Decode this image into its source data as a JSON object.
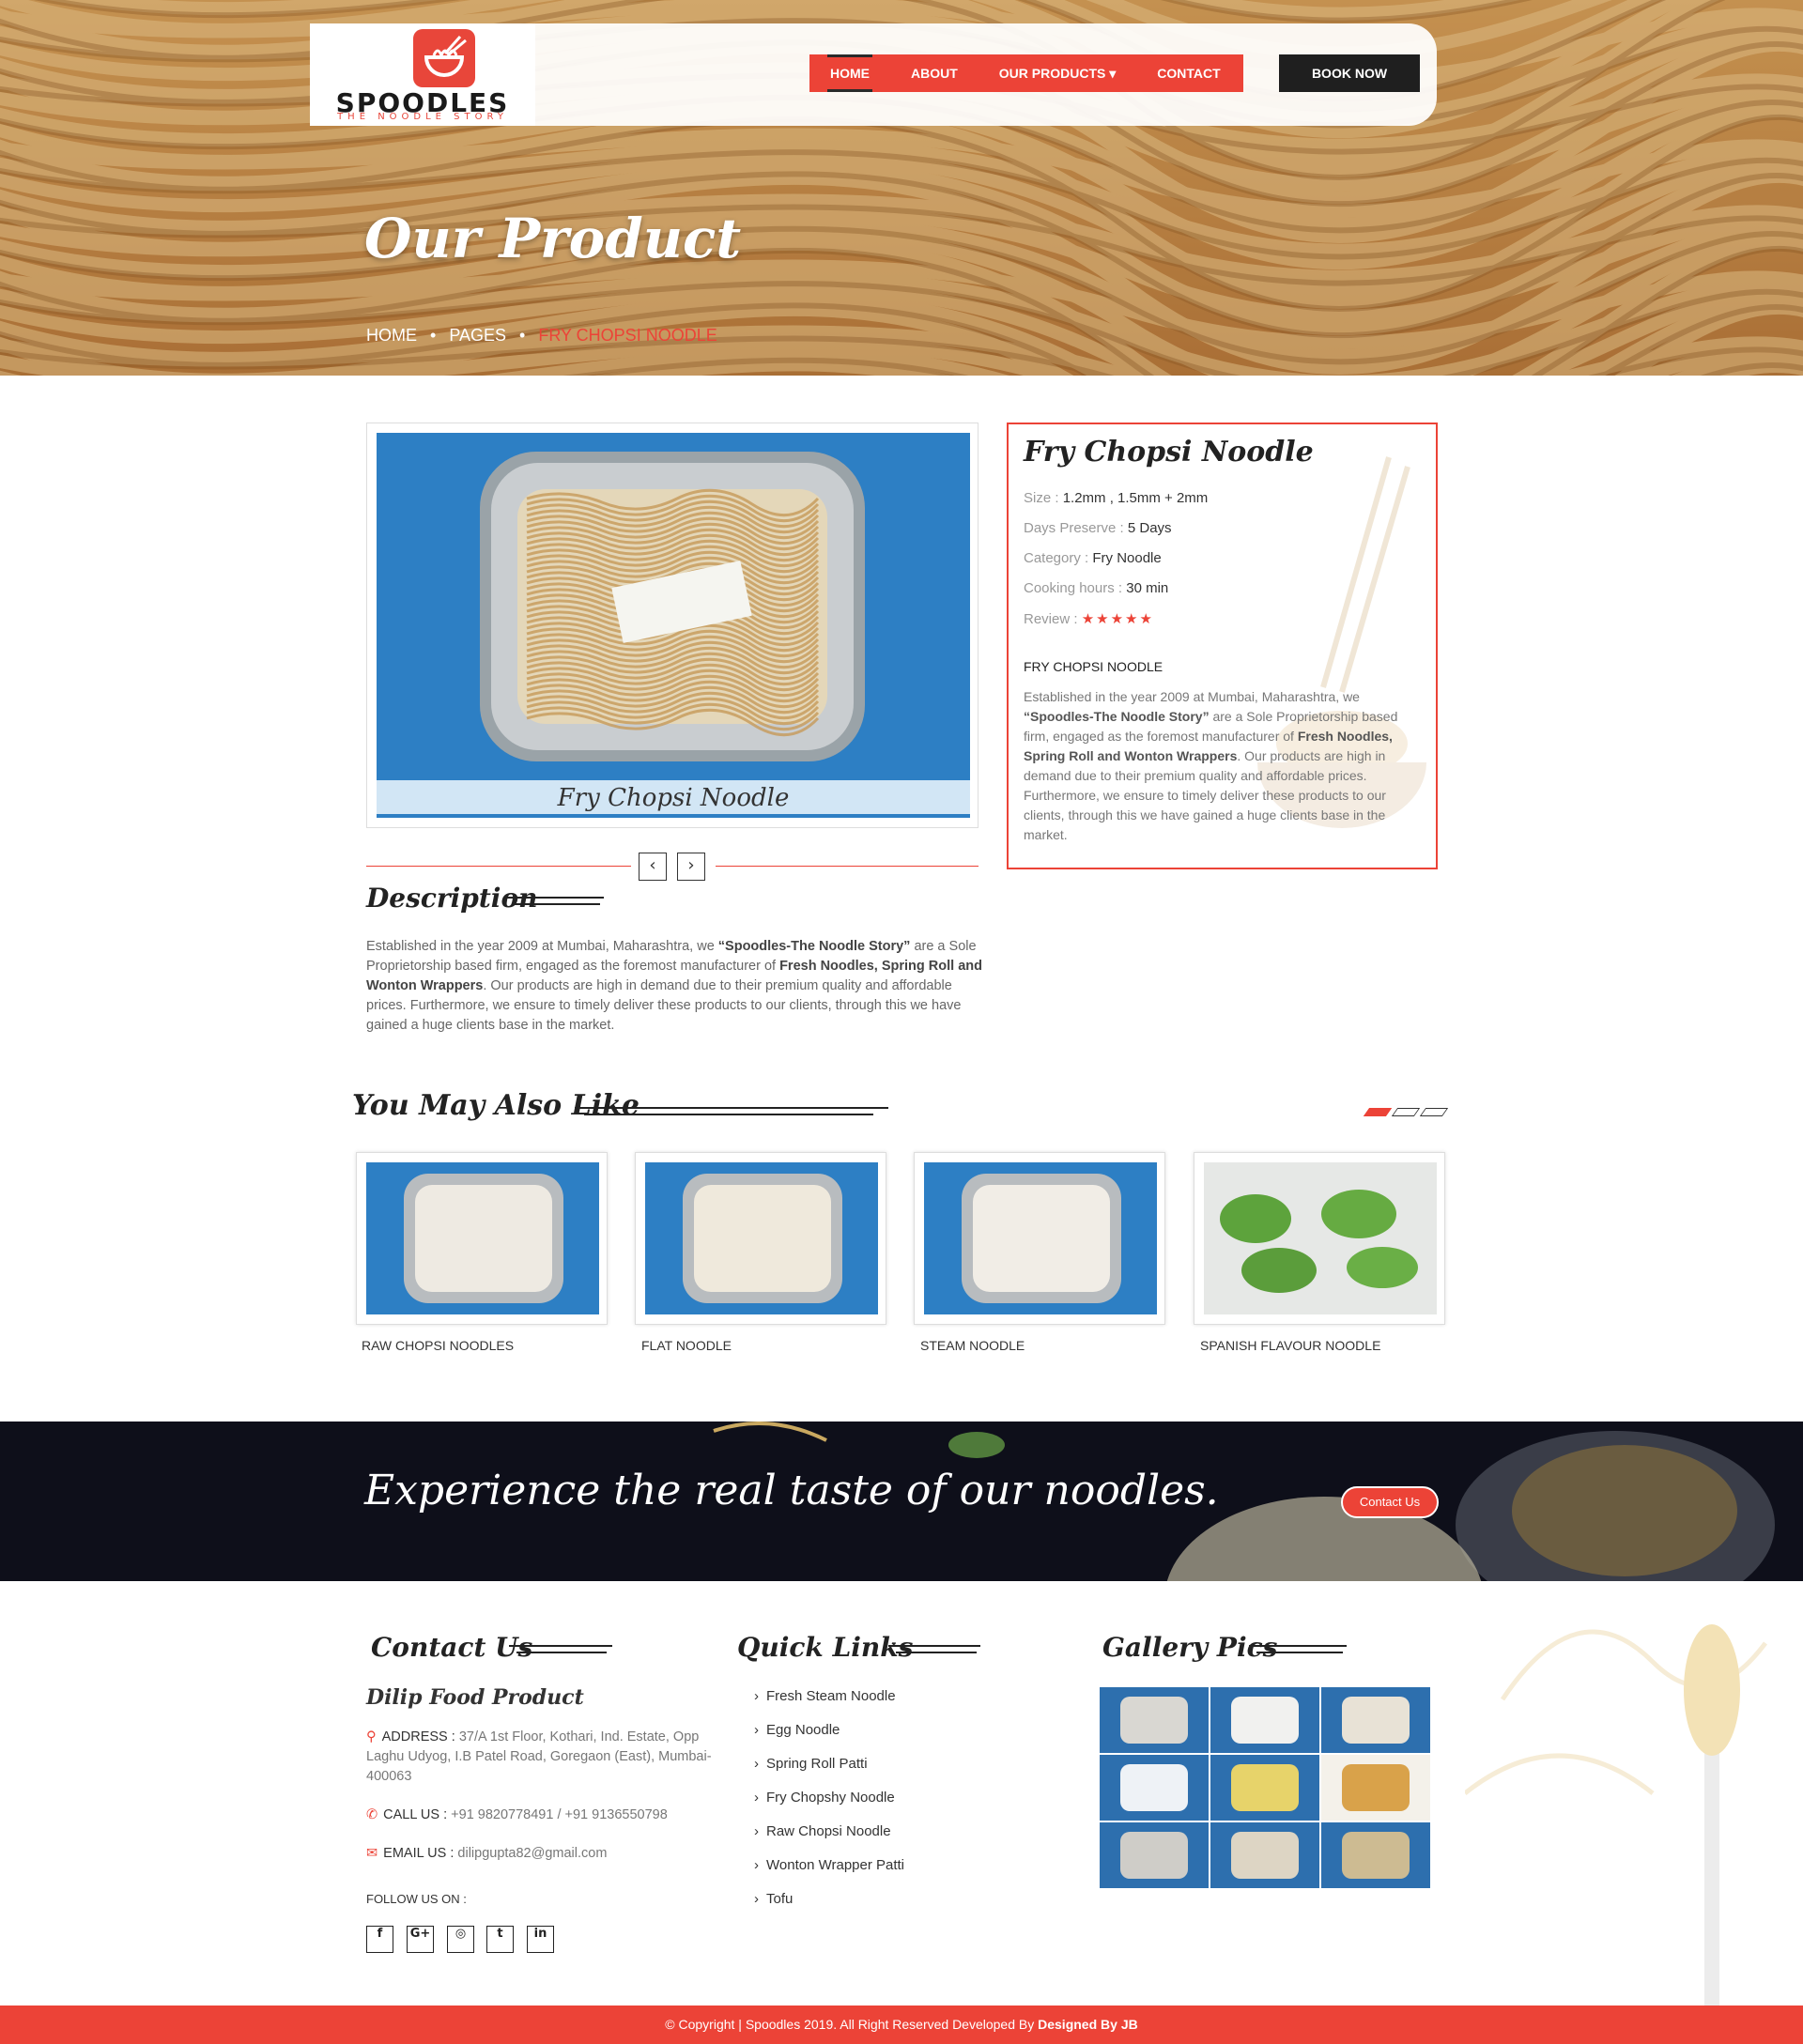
{
  "brand": {
    "name": "SPOODLES",
    "tagline": "THE NOODLE STORY"
  },
  "nav": {
    "items": [
      "HOME",
      "ABOUT",
      "OUR PRODUCTS ▾",
      "CONTACT"
    ],
    "active": "HOME",
    "book_now": "BOOK NOW"
  },
  "hero": {
    "title": "Our Product",
    "breadcrumb": [
      "HOME",
      "PAGES",
      "FRY CHOPSI NOODLE"
    ]
  },
  "product": {
    "image_caption": "Fry Chopsi Noodle",
    "name": "Fry Chopsi Noodle",
    "specs": [
      {
        "label": "Size :",
        "value": "1.2mm , 1.5mm + 2mm"
      },
      {
        "label": "Days Preserve :",
        "value": "5 Days"
      },
      {
        "label": "Category :",
        "value": "Fry Noodle"
      },
      {
        "label": "Cooking hours :",
        "value": "30 min"
      }
    ],
    "review_label": "Review :",
    "review_stars": 5,
    "heading": "FRY CHOPSI NOODLE",
    "info": {
      "p1": "Established in the year 2009 at Mumbai, Maharashtra, we ",
      "b1": "“Spoodles-The Noodle Story”",
      "p2": " are a Sole Proprietorship based firm, engaged as the foremost manufacturer of ",
      "b2": "Fresh Noodles, Spring Roll and Wonton Wrappers",
      "p3": ". Our products are high in demand due to their premium quality and affordable prices. Furthermore, we ensure to timely deliver these products to our clients, through this we have gained a huge clients base in the market."
    },
    "prev_label": "‹",
    "next_label": "›"
  },
  "description": {
    "title": "Description",
    "p1": "Established in the year 2009 at Mumbai, Maharashtra, we ",
    "b1": "“Spoodles-The Noodle Story”",
    "p2": " are a Sole Proprietorship based firm, engaged as the foremost manufacturer of ",
    "b2": "Fresh Noodles, Spring Roll and Wonton Wrappers",
    "p3": ". Our products are high in demand due to their premium quality and affordable prices. Furthermore, we ensure to timely deliver these products to our clients, through this we have gained a huge clients base in the market."
  },
  "also_like": {
    "title": "You May Also Like",
    "items": [
      "RAW CHOPSI NOODLES",
      "FLAT NOODLE",
      "STEAM NOODLE",
      "SPANISH FLAVOUR NOODLE"
    ],
    "active_page": 1,
    "pages": 3
  },
  "banner": {
    "text": "Experience the real taste of our noodles.",
    "button": "Contact Us"
  },
  "footer": {
    "contact_title": "Contact Us",
    "company": "Dilip Food Product",
    "address_label": "ADDRESS :",
    "address": "37/A 1st Floor, Kothari, Ind. Estate, Opp Laghu Udyog, I.B Patel Road, Goregaon (East), Mumbai-400063",
    "call_label": "CALL US :",
    "call": "+91 9820778491 / +91 9136550798",
    "email_label": "EMAIL US :",
    "email": "dilipgupta82@gmail.com",
    "follow": "FOLLOW US ON :",
    "social": [
      "f",
      "G+",
      "◎",
      "t",
      "in"
    ],
    "social_names": [
      "facebook-icon",
      "google-plus-icon",
      "instagram-icon",
      "twitter-icon",
      "linkedin-icon"
    ],
    "quick_title": "Quick Links",
    "quick_links": [
      "Fresh Steam Noodle",
      "Egg Noodle",
      "Spring Roll Patti",
      "Fry Chopshy Noodle",
      "Raw Chopsi Noodle",
      "Wonton Wrapper Patti",
      "Tofu"
    ],
    "gallery_title": "Gallery Pics"
  },
  "copyright": {
    "text": "© Copyright | Spoodles 2019. All Right Reserved Developed By ",
    "credit": "Designed By JB"
  },
  "colors": {
    "accent": "#ec4337",
    "dark": "#1f1f1f",
    "banner": "#0e0f1a",
    "photo_blue": "#2d7fc4"
  }
}
